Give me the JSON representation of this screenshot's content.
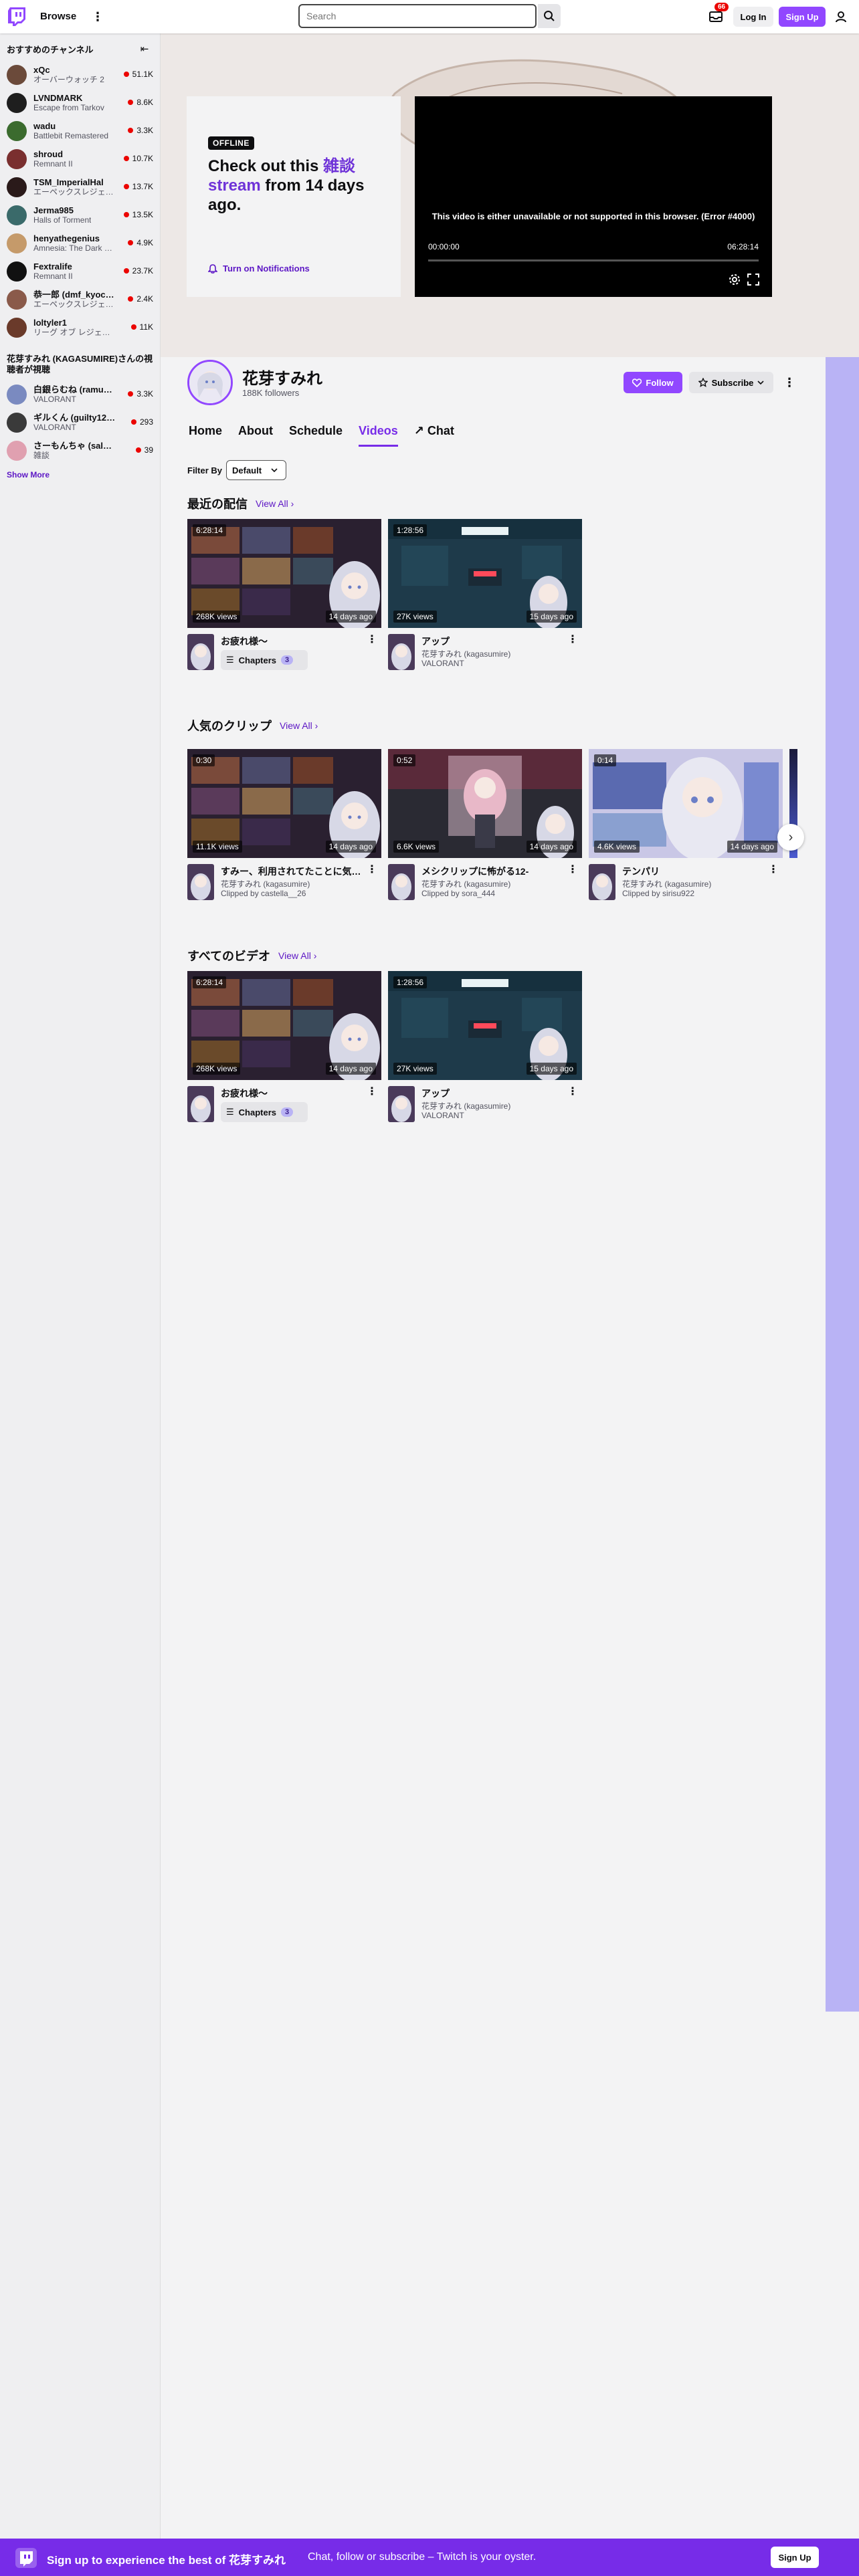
{
  "nav": {
    "browse": "Browse",
    "search_placeholder": "Search",
    "inbox_badge": "66",
    "login": "Log In",
    "signup": "Sign Up"
  },
  "sidebar": {
    "heading": "おすすめのチャンネル",
    "channels": [
      {
        "name": "xQc",
        "game": "オーバーウォッチ 2",
        "viewers": "51.1K",
        "color": "#6b4a3a"
      },
      {
        "name": "LVNDMARK",
        "game": "Escape from Tarkov",
        "viewers": "8.6K",
        "color": "#1e1e1e"
      },
      {
        "name": "wadu",
        "game": "Battlebit Remastered",
        "viewers": "3.3K",
        "color": "#3b6b2e"
      },
      {
        "name": "shroud",
        "game": "Remnant II",
        "viewers": "10.7K",
        "color": "#7a2f2f"
      },
      {
        "name": "TSM_ImperialHal",
        "game": "エーペックスレジェ…",
        "viewers": "13.7K",
        "color": "#2a1a1a"
      },
      {
        "name": "Jerma985",
        "game": "Halls of Torment",
        "viewers": "13.5K",
        "color": "#3a6a6a"
      },
      {
        "name": "henyathegenius",
        "game": "Amnesia: The Dark …",
        "viewers": "4.9K",
        "color": "#c59a6a"
      },
      {
        "name": "Fextralife",
        "game": "Remnant II",
        "viewers": "23.7K",
        "color": "#111111"
      },
      {
        "name": "恭一郎 (dmf_kyoc…",
        "game": "エーペックスレジェ…",
        "viewers": "2.4K",
        "color": "#8a5a4a"
      },
      {
        "name": "loltyler1",
        "game": "リーグ オブ レジェ…",
        "viewers": "11K",
        "color": "#6a3a2a"
      }
    ],
    "heading2": "花芽すみれ (KAGASUMIRE)さんの視聴者が視聴",
    "channels2": [
      {
        "name": "白銀らむね (ramu…",
        "game": "VALORANT",
        "viewers": "3.3K",
        "color": "#7a8ac0"
      },
      {
        "name": "ギルくん (guilty12…",
        "game": "VALORANT",
        "viewers": "293",
        "color": "#3a3a3a"
      },
      {
        "name": "さーもんちゃ (sal…",
        "game": "雑談",
        "viewers": "39",
        "color": "#e0a0b0"
      }
    ],
    "show_more": "Show More"
  },
  "banner": {
    "offline_badge": "OFFLINE",
    "offline_pre": "Check out this ",
    "offline_hl1": "雑談",
    "offline_hl2": "stream",
    "offline_post": " from 14 days ago.",
    "notify": "Turn on Notifications"
  },
  "player": {
    "error": "This video is either unavailable or not supported in this browser. (Error #4000)",
    "time_current": "00:00:00",
    "time_total": "06:28:14"
  },
  "channel": {
    "name": "花芽すみれ",
    "followers": "188K followers",
    "follow": "Follow",
    "subscribe": "Subscribe"
  },
  "tabs": [
    "Home",
    "About",
    "Schedule",
    "Videos",
    "Chat"
  ],
  "filter": {
    "label": "Filter By",
    "value": "Default"
  },
  "sections": {
    "recent": {
      "title": "最近の配信",
      "view_all": "View All"
    },
    "clips": {
      "title": "人気のクリップ",
      "view_all": "View All"
    },
    "all": {
      "title": "すべてのビデオ",
      "view_all": "View All"
    }
  },
  "recent_videos": [
    {
      "duration": "6:28:14",
      "views": "268K views",
      "age": "14 days ago",
      "title": "お疲れ様〜",
      "chapters": "Chapters",
      "chapter_count": "3"
    },
    {
      "duration": "1:28:56",
      "views": "27K views",
      "age": "15 days ago",
      "title": "アップ",
      "channel": "花芽すみれ (kagasumire)",
      "game": "VALORANT"
    }
  ],
  "clips": [
    {
      "duration": "0:30",
      "views": "11.1K views",
      "age": "14 days ago",
      "title": "すみー、利用されてたことに気…",
      "channel": "花芽すみれ (kagasumire)",
      "clipper": "Clipped by castella__26"
    },
    {
      "duration": "0:52",
      "views": "6.6K views",
      "age": "14 days ago",
      "title": "メシクリップに怖がる12-",
      "channel": "花芽すみれ (kagasumire)",
      "clipper": "Clipped by sora_444"
    },
    {
      "duration": "0:14",
      "views": "4.6K views",
      "age": "14 days ago",
      "title": "テンパリ",
      "channel": "花芽すみれ (kagasumire)",
      "clipper": "Clipped by sirisu922"
    }
  ],
  "all_videos": [
    {
      "duration": "6:28:14",
      "views": "268K views",
      "age": "14 days ago",
      "title": "お疲れ様〜",
      "chapters": "Chapters",
      "chapter_count": "3"
    },
    {
      "duration": "1:28:56",
      "views": "27K views",
      "age": "15 days ago",
      "title": "アップ",
      "channel": "花芽すみれ (kagasumire)",
      "game": "VALORANT"
    }
  ],
  "bottom_bar": {
    "text_bold": "Sign up to experience the best of 花芽すみれ",
    "text": "Chat, follow or subscribe – Twitch is your oyster.",
    "signup": "Sign Up"
  },
  "colors": {
    "brand": "#9147ff",
    "accent_text": "#772ce8",
    "live": "#eb0400"
  }
}
